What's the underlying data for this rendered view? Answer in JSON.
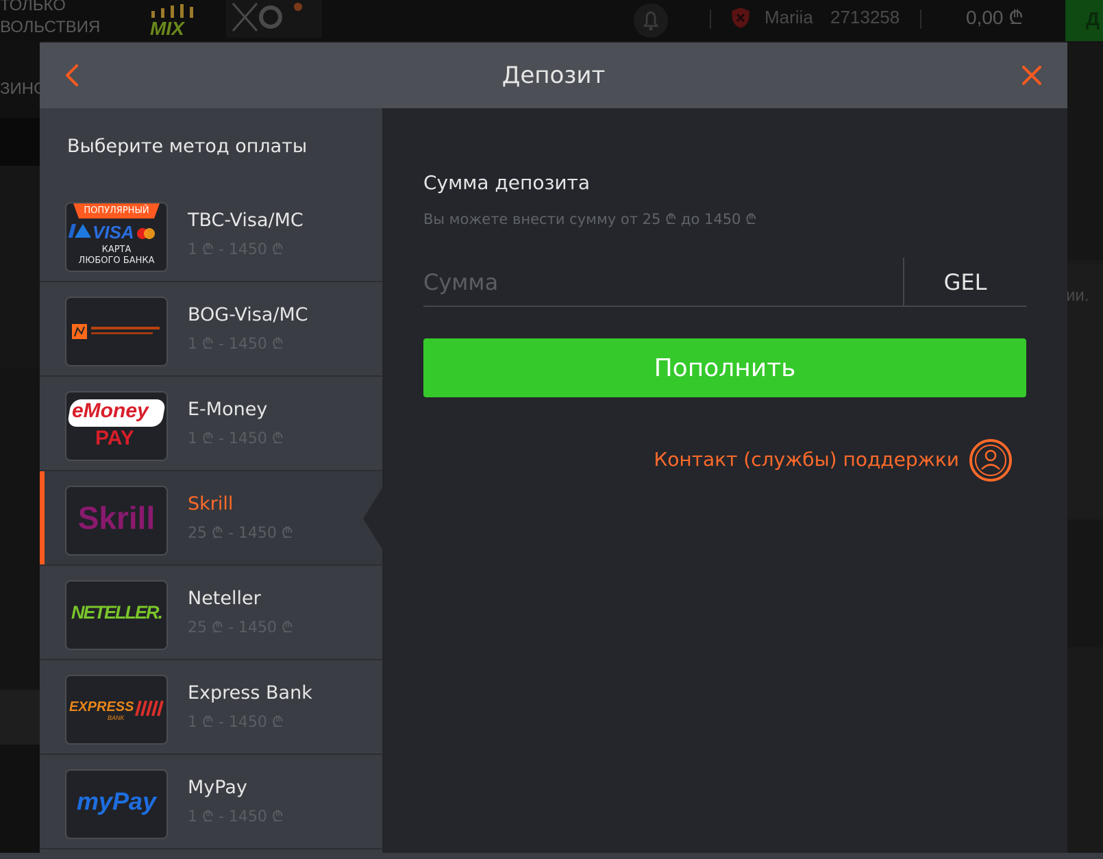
{
  "background": {
    "left_top_line1": "ТОЛЬКО",
    "left_top_line2": "ВОЛЬСТВИЯ",
    "left_mid": "ЗИНО",
    "mix_label": "MIX",
    "user_name": "Mariia",
    "user_id": "2713258",
    "balance": "0,00 ₾",
    "right_button_letter": "Д",
    "right_text": "ии."
  },
  "modal": {
    "title": "Депозит",
    "back_icon": "chevron-left-icon",
    "close_icon": "close-icon",
    "accent_color": "#ff5a1f",
    "sidebar_title": "Выберите метод оплаты",
    "methods": [
      {
        "name": "TBC-Visa/MC",
        "range": "1 ₾ - 1450 ₾",
        "logo": "tbc-visa-mastercard-logo",
        "badge": "ПОПУЛЯРНЫЙ",
        "logo_line1": "КАРТА",
        "logo_line2": "ЛЮБОГО БАНКА",
        "visa": "VISA",
        "active": false
      },
      {
        "name": "BOG-Visa/MC",
        "range": "1 ₾ - 1450 ₾",
        "logo": "bank-of-georgia-logo",
        "active": false
      },
      {
        "name": "E-Money",
        "range": "1 ₾ - 1450 ₾",
        "logo": "emoney-pay-logo",
        "logo_top": "eMoney",
        "logo_bottom": "PAY",
        "active": false
      },
      {
        "name": "Skrill",
        "range": "25 ₾ - 1450 ₾",
        "logo": "skrill-logo",
        "logo_text": "Skrill",
        "active": true
      },
      {
        "name": "Neteller",
        "range": "25 ₾ - 1450 ₾",
        "logo": "neteller-logo",
        "logo_text": "NETELLER.",
        "active": false
      },
      {
        "name": "Express Bank",
        "range": "1 ₾ - 1450 ₾",
        "logo": "express-bank-logo",
        "logo_text": "EXPRESS",
        "logo_sub": "BANK",
        "active": false
      },
      {
        "name": "MyPay",
        "range": "1 ₾ - 1450 ₾",
        "logo": "mypay-logo",
        "logo_text": "myPay",
        "active": false
      }
    ],
    "deposit": {
      "title": "Сумма депозита",
      "hint": "Вы можете внести сумму от 25 ₾ до 1450 ₾",
      "amount_placeholder": "Сумма",
      "amount_value": "",
      "currency": "GEL",
      "submit_label": "Пополнить",
      "submit_color": "#35c92b",
      "support_label": "Контакт (службы) поддержки",
      "support_icon": "support-person-icon"
    }
  }
}
